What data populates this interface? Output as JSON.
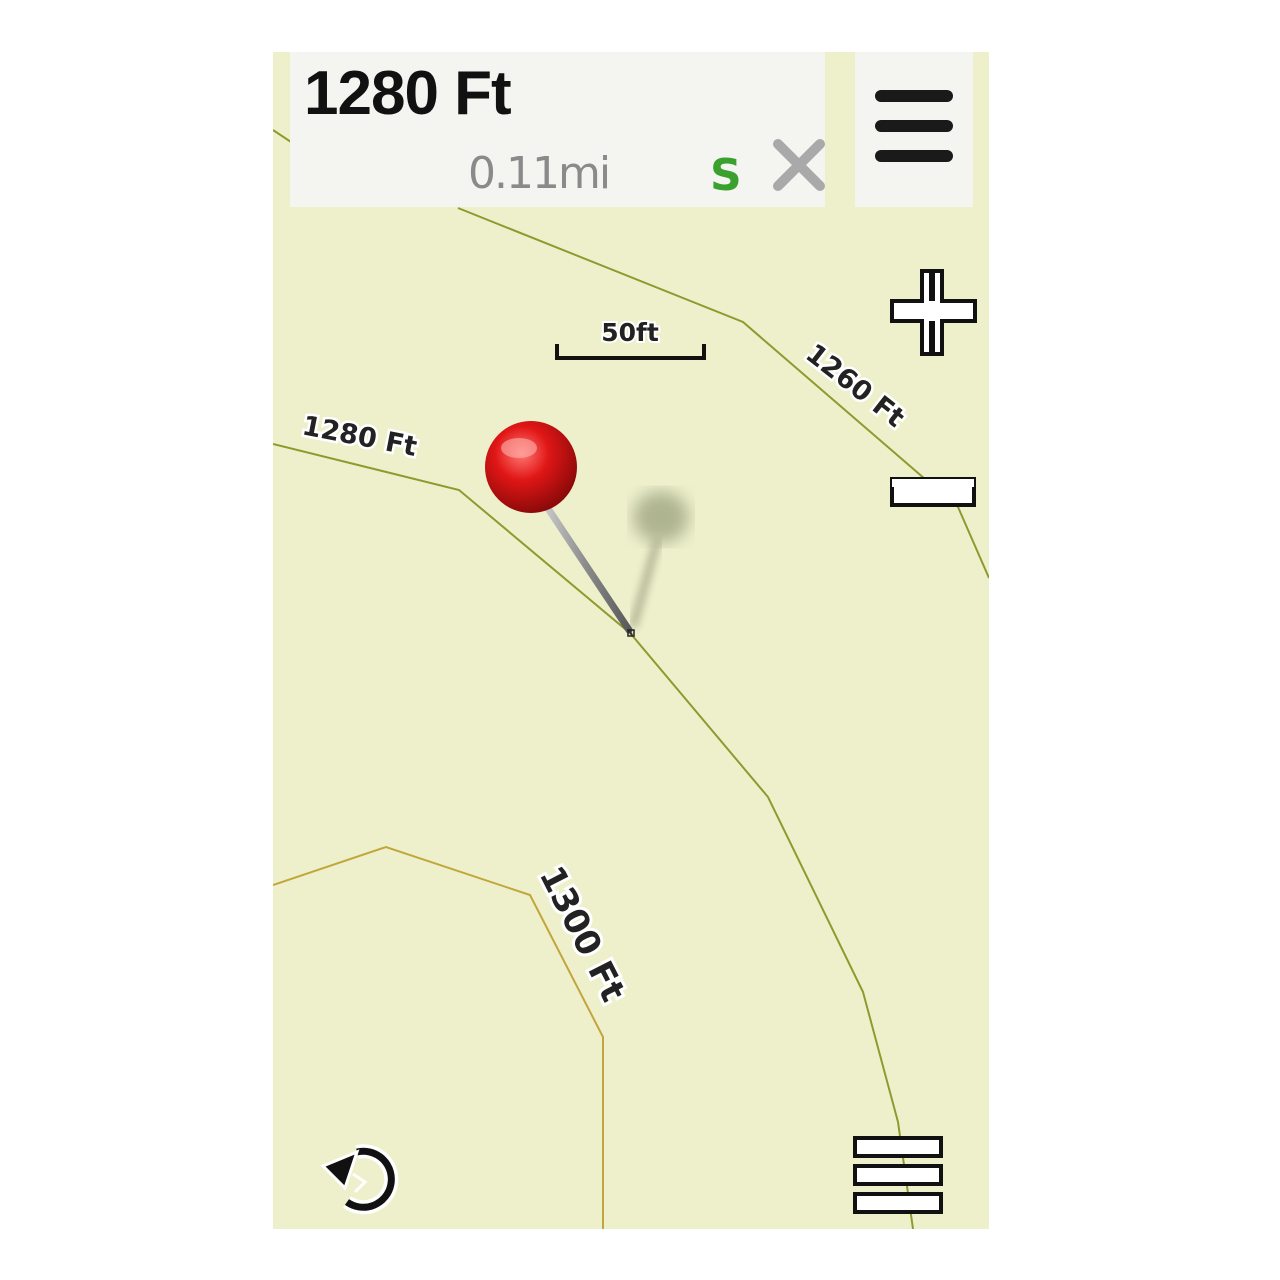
{
  "header": {
    "elevation": "1280 Ft",
    "distance": "0.11mi",
    "direction": "S"
  },
  "map": {
    "scale_label": "50ft",
    "contours": [
      {
        "label": "1260 Ft"
      },
      {
        "label": "1280 Ft"
      },
      {
        "label": "1300 Ft"
      }
    ],
    "background_color": "#eef0cc",
    "contour_color": "#8f9a2e",
    "marker": "red-map-pin"
  },
  "controls": {
    "zoom_in": "plus-icon",
    "zoom_out": "minus-icon",
    "back": "back-arrow-icon",
    "menu": "hamburger-icon",
    "list": "list-icon"
  }
}
